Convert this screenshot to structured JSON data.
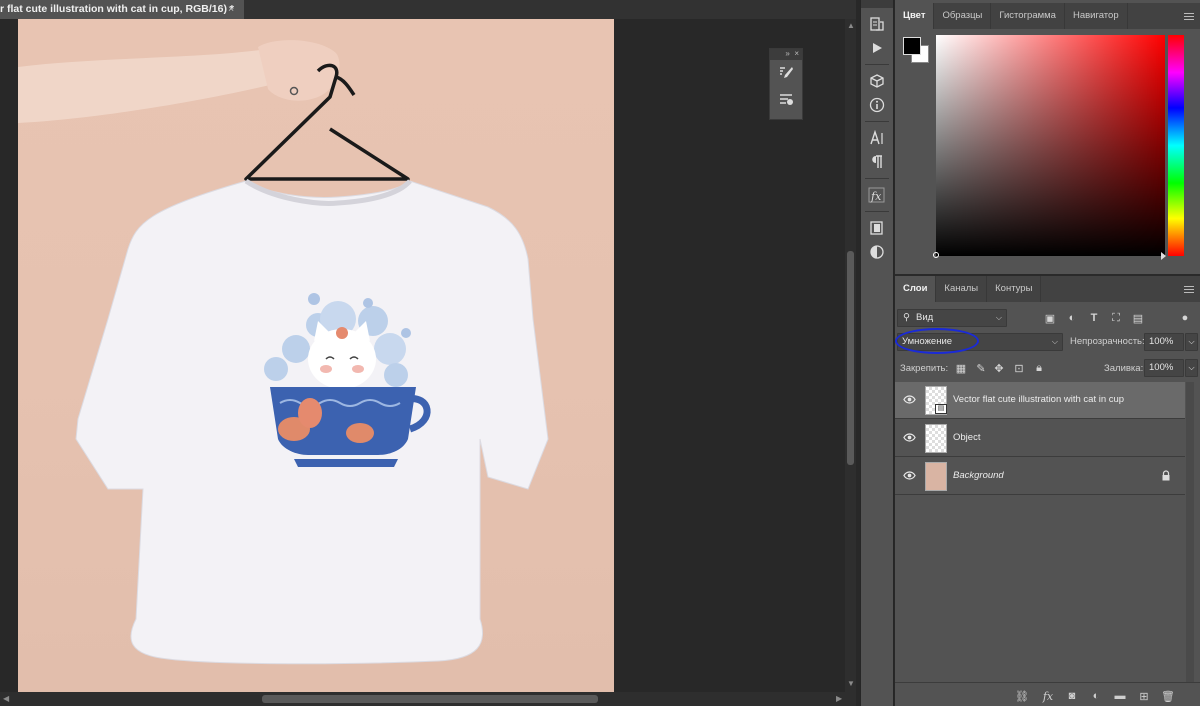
{
  "document": {
    "tab_title": "r flat cute illustration with cat in cup, RGB/16) *",
    "close_glyph": "×"
  },
  "toolstrip": {
    "icons": [
      "history-icon",
      "play-actions-icon",
      "3d-cube-icon",
      "info-icon",
      "character-icon",
      "paragraph-icon",
      "fx-styles-icon",
      "libraries-icon",
      "adjustments-icon"
    ]
  },
  "color_panel": {
    "tabs": [
      "Цвет",
      "Образцы",
      "Гистограмма",
      "Навигатор"
    ],
    "active_tab": "Цвет",
    "foreground": "#000000",
    "background": "#ffffff",
    "hue_color": "#ff0000"
  },
  "layers_panel": {
    "tabs": [
      "Слои",
      "Каналы",
      "Контуры"
    ],
    "active_tab": "Слои",
    "filter_label": "Вид",
    "blend_mode": "Умножение",
    "opacity_label": "Непрозрачность:",
    "opacity_value": "100%",
    "lock_label": "Закрепить:",
    "fill_label": "Заливка:",
    "fill_value": "100%",
    "layers": [
      {
        "name": "Vector flat cute illustration with cat in cup",
        "selected": true,
        "italic": false,
        "locked": false
      },
      {
        "name": "Object",
        "selected": false,
        "italic": false,
        "locked": false
      },
      {
        "name": "Background",
        "selected": false,
        "italic": true,
        "locked": true
      }
    ]
  },
  "annotation": {
    "color": "#1a2ad8"
  }
}
